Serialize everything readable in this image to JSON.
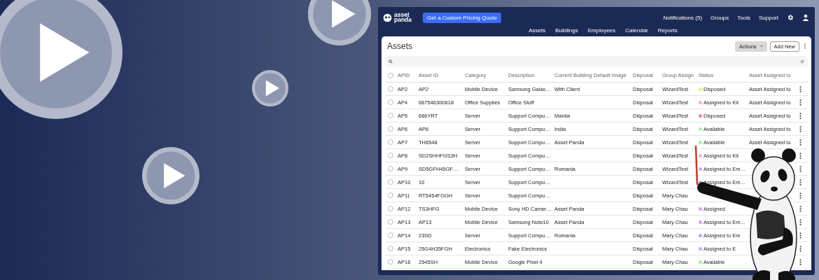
{
  "header": {
    "logo": {
      "line1": "asset",
      "line2": "panda"
    },
    "quote_button": "Get a Custom Pricing Quote",
    "links": [
      "Notifications (5)",
      "Groups",
      "Tools",
      "Support"
    ],
    "nav": [
      "Assets",
      "Buildings",
      "Employees",
      "Calendar",
      "Reports"
    ]
  },
  "card": {
    "title": "Assets",
    "actions_button": "Actions",
    "add_button": "Add New"
  },
  "table": {
    "select_all_checked": false,
    "columns": [
      "APID",
      "Asset ID",
      "Category",
      "Description",
      "Current Building",
      "Default Image",
      "Disposal",
      "Group Assign",
      "Status",
      "Asset Assigned to"
    ],
    "rows": [
      {
        "checked": false,
        "apid": "AP2",
        "asset_id": "AP2",
        "category": "Mobile Device",
        "description": "Samsung Galax…",
        "building": "With Client",
        "disposal": "Disposal",
        "group": "WizardTest",
        "status": "Disposed",
        "color": "#f2ec86",
        "assigned": "Asset Assigned to"
      },
      {
        "checked": false,
        "apid": "AP4",
        "asset_id": "667546300818",
        "category": "Office Supplies",
        "description": "Office Stuff",
        "building": "",
        "disposal": "Disposal",
        "group": "WizardTest",
        "status": "Assigned to Kit",
        "color": "#f5b0e6",
        "assigned": "Asset Assigned to"
      },
      {
        "checked": false,
        "apid": "AP5",
        "asset_id": "666YRT",
        "category": "Server",
        "description": "Support Compu…",
        "building": "Manila",
        "disposal": "Disposal",
        "group": "WizardTest",
        "status": "Disposed",
        "color": "#f08a8a",
        "assigned": "Asset Assigned to"
      },
      {
        "checked": false,
        "apid": "AP6",
        "asset_id": "AP6",
        "category": "Server",
        "description": "Support Compu…",
        "building": "India",
        "disposal": "Disposal",
        "group": "WizardTest",
        "status": "Available",
        "color": "#abeeab",
        "assigned": "Asset Assigned to"
      },
      {
        "checked": false,
        "apid": "AP7",
        "asset_id": "TH6548",
        "category": "Server",
        "description": "Support Compu…",
        "building": "Asset Panda",
        "disposal": "Disposal",
        "group": "WizardTest",
        "status": "Available",
        "color": "#abeeab",
        "assigned": "Asset Assigned to"
      },
      {
        "checked": false,
        "apid": "AP8",
        "asset_id": "SD2SHHFGS3H",
        "category": "Server",
        "description": "Support Compu…",
        "building": "",
        "disposal": "Disposal",
        "group": "WizardTest",
        "status": "Assigned to Kit",
        "color": "#f5b0e6",
        "assigned": ""
      },
      {
        "checked": false,
        "apid": "AP9",
        "asset_id": "SD5GFH45GF…",
        "category": "Server",
        "description": "Support Compu…",
        "building": "Romania",
        "disposal": "Disposal",
        "group": "WizardTest",
        "status": "Assigned to Em…",
        "color": "#c8a8f4",
        "assigned": ""
      },
      {
        "checked": false,
        "apid": "AP10",
        "asset_id": "10",
        "category": "Server",
        "description": "Support Compu…",
        "building": "",
        "disposal": "Disposal",
        "group": "WizardTest",
        "status": "Assigned to Em…",
        "color": "#c8a8f4",
        "assigned": ""
      },
      {
        "checked": false,
        "apid": "AP11",
        "asset_id": "RT5454FGGH",
        "category": "Server",
        "description": "Support Compu…",
        "building": "",
        "disposal": "Disposal",
        "group": "Mary Chau",
        "status": "",
        "assigned": ""
      },
      {
        "checked": false,
        "apid": "AP12",
        "asset_id": "TS3HFG",
        "category": "Mobile Device",
        "description": "Sony HD Camer…",
        "building": "Asset Panda",
        "disposal": "Disposal",
        "group": "Mary Chau",
        "status": "Assigned",
        "color": "#c8a8f4",
        "assigned": ""
      },
      {
        "checked": false,
        "apid": "AP13",
        "asset_id": "AP13",
        "category": "Mobile Device",
        "description": "Samsung Note10",
        "building": "Asset Panda",
        "disposal": "Disposal",
        "group": "Mary Chau",
        "status": "Assigned to Em…",
        "color": "#c8a8f4",
        "assigned": ""
      },
      {
        "checked": false,
        "apid": "AP14",
        "asset_id": "23SD",
        "category": "Server",
        "description": "Support Compu…",
        "building": "Romania",
        "disposal": "Disposal",
        "group": "Mary Chau",
        "status": "Assigned to Em",
        "color": "#c8a8f4",
        "assigned": ""
      },
      {
        "checked": false,
        "apid": "AP15",
        "asset_id": "25G4H35FGH",
        "category": "Electronics",
        "description": "Fake Electronics",
        "building": "",
        "disposal": "Disposal",
        "group": "Mary Chau",
        "status": "Assigned to E",
        "color": "#c8a8f4",
        "assigned": ""
      },
      {
        "checked": false,
        "apid": "AP16",
        "asset_id": "2545SH",
        "category": "Mobile Device",
        "description": "Google Pixel 4",
        "building": "",
        "disposal": "Disposal",
        "group": "Mary Chau",
        "status": "Available",
        "color": "#abeeab",
        "assigned": ""
      }
    ]
  }
}
